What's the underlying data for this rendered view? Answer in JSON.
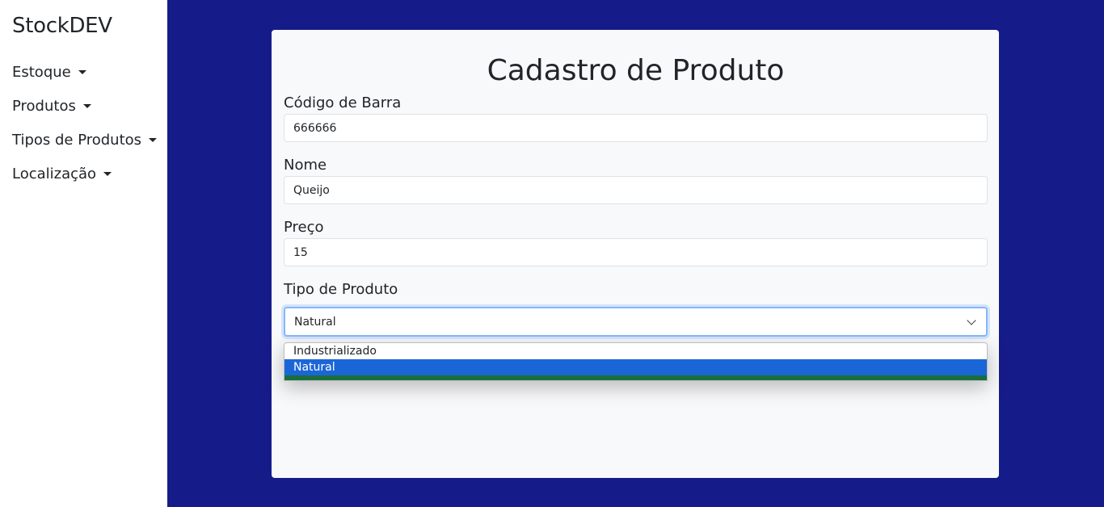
{
  "sidebar": {
    "brand": "StockDEV",
    "items": [
      {
        "label": "Estoque"
      },
      {
        "label": "Produtos"
      },
      {
        "label": "Tipos de Produtos"
      },
      {
        "label": "Localização"
      }
    ]
  },
  "form": {
    "title": "Cadastro de Produto",
    "barcode": {
      "label": "Código de Barra",
      "value": "666666"
    },
    "name": {
      "label": "Nome",
      "value": "Queijo"
    },
    "price": {
      "label": "Preço",
      "value": "15"
    },
    "type": {
      "label": "Tipo de Produto",
      "selected": "Natural",
      "options": [
        "Industrializado",
        "Natural"
      ]
    }
  },
  "colors": {
    "background": "#161b8a",
    "card": "#f8f9fa",
    "selected_option": "#1b66d6",
    "focus_border": "#86b7fe",
    "button_green": "#1a6e3e"
  }
}
